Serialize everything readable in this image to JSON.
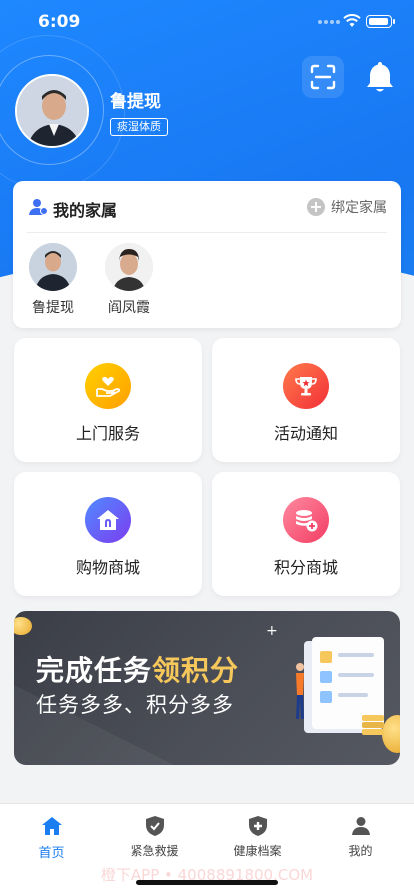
{
  "status_bar": {
    "time": "6:09"
  },
  "profile": {
    "name": "鲁提现",
    "constitution_badge": "痰湿体质"
  },
  "icons": {
    "scan": "scan-icon",
    "bell": "bell-icon"
  },
  "family": {
    "title": "我的家属",
    "bind_label": "绑定家属",
    "members": [
      {
        "name": "鲁提现"
      },
      {
        "name": "阎凤霞"
      }
    ]
  },
  "services": [
    {
      "label": "上门服务",
      "icon": "hand-heart-icon",
      "color_from": "#ffc400",
      "color_to": "#ff9f00"
    },
    {
      "label": "活动通知",
      "icon": "trophy-icon",
      "color_from": "#ff6b4a",
      "color_to": "#f5303a"
    },
    {
      "label": "购物商城",
      "icon": "shop-icon",
      "color_from": "#5b7cff",
      "color_to": "#7d3cf0"
    },
    {
      "label": "积分商城",
      "icon": "points-coin-icon",
      "color_from": "#ff7f95",
      "color_to": "#f23d63"
    }
  ],
  "banner": {
    "headline_prefix": "完成任务",
    "headline_highlight": "领积分",
    "subline": "任务多多、积分多多"
  },
  "tabbar": [
    {
      "label": "首页",
      "icon": "home-icon",
      "active": true
    },
    {
      "label": "紧急救援",
      "icon": "shield-check-icon",
      "active": false
    },
    {
      "label": "健康档案",
      "icon": "medical-shield-icon",
      "active": false
    },
    {
      "label": "我的",
      "icon": "user-icon",
      "active": false
    }
  ],
  "watermark": "橙下APP • 4008891800.COM",
  "colors": {
    "primary": "#1a7ef0",
    "highlight": "#f6c75a"
  }
}
